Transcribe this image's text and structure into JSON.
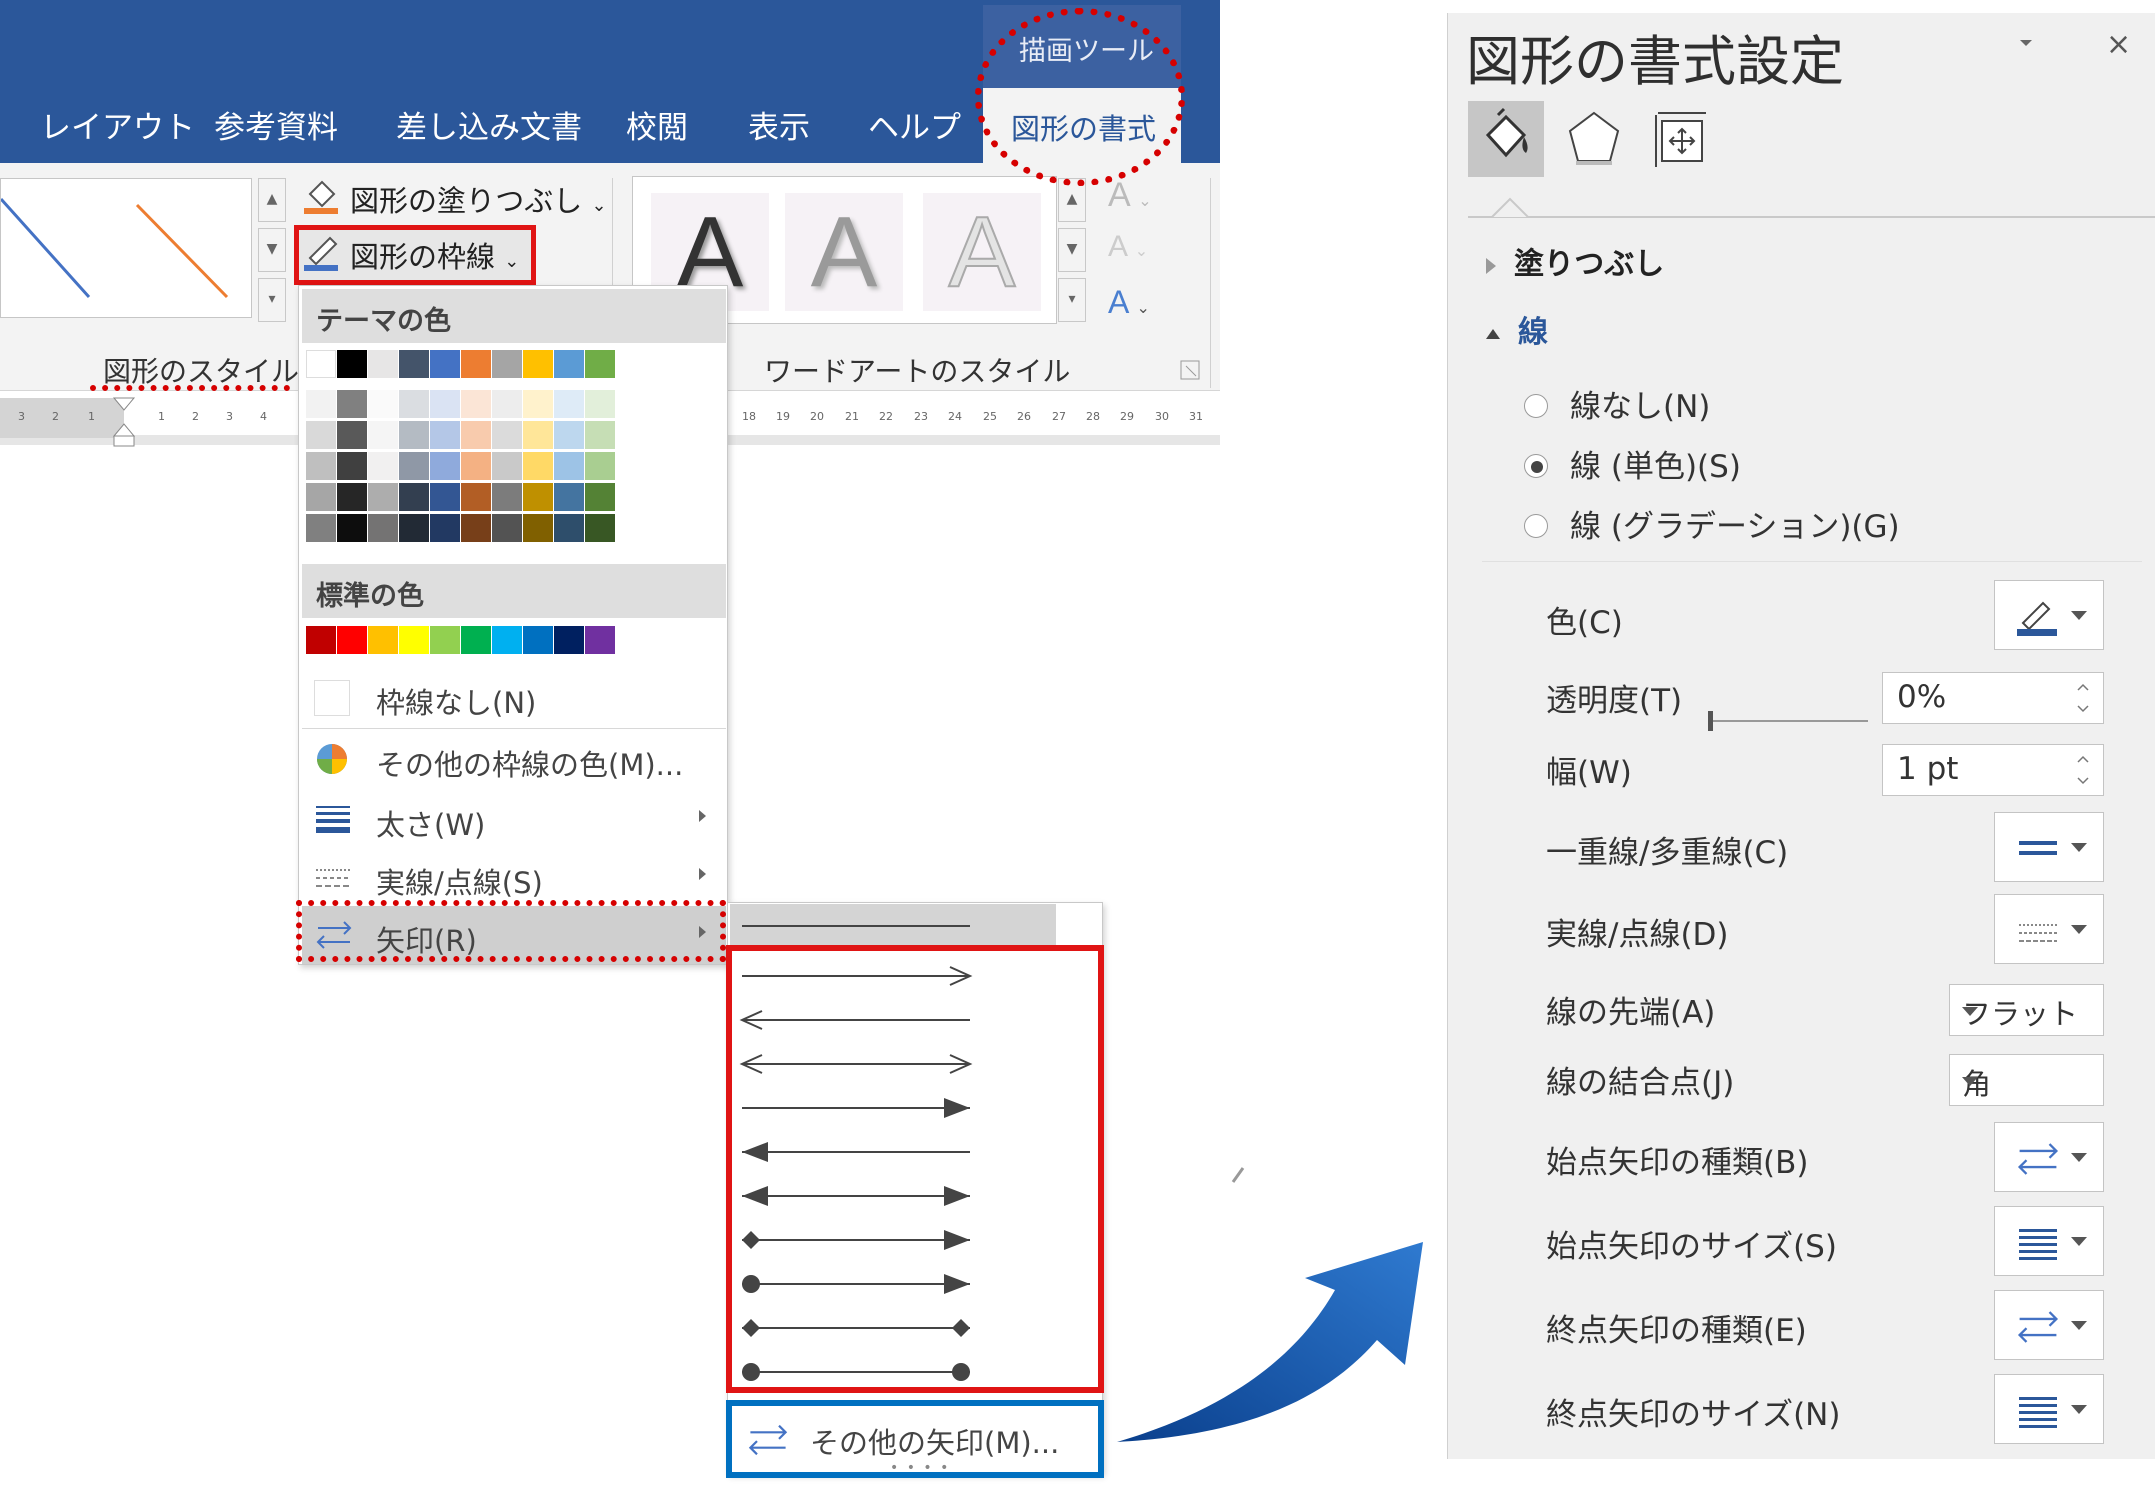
{
  "ribbon": {
    "tabs": [
      "レイアウト",
      "参考資料",
      "差し込み文書",
      "校閲",
      "表示",
      "ヘルプ"
    ],
    "contextual_group": "描画ツール",
    "active_tab": "図形の書式",
    "fill_command": "図形の塗りつぶし",
    "outline_command": "図形の枠線",
    "shape_styles_label": "図形のスタイル",
    "wordart_styles_label": "ワードアートのスタイル",
    "wordart_letter": "A"
  },
  "ruler": {
    "ticks": [
      "3",
      "2",
      "1",
      "1",
      "2",
      "3",
      "4",
      "18",
      "19",
      "20",
      "21",
      "22",
      "23",
      "24",
      "25",
      "26",
      "27",
      "28",
      "29",
      "30",
      "31"
    ]
  },
  "outline_menu": {
    "theme_colors_header": "テーマの色",
    "standard_colors_header": "標準の色",
    "theme_colors": [
      "#ffffff",
      "#000000",
      "#e7e6e6",
      "#44546a",
      "#4472c4",
      "#ed7d31",
      "#a5a5a5",
      "#ffc000",
      "#5b9bd5",
      "#70ad47"
    ],
    "standard_colors": [
      "#c00000",
      "#ff0000",
      "#ffc000",
      "#ffff00",
      "#92d050",
      "#00b050",
      "#00b0f0",
      "#0070c0",
      "#002060",
      "#7030a0"
    ],
    "no_outline": "枠線なし(N)",
    "more_colors": "その他の枠線の色(M)...",
    "weight": "太さ(W)",
    "dashes": "実線/点線(S)",
    "arrows": "矢印(R)"
  },
  "arrow_submenu": {
    "more_arrows": "その他の矢印(M)..."
  },
  "format_pane": {
    "title": "図形の書式設定",
    "close": "×",
    "fill_section": "塗りつぶし",
    "line_section": "線",
    "radio_options": [
      {
        "label": "線なし(N)",
        "checked": false
      },
      {
        "label": "線 (単色)(S)",
        "checked": true
      },
      {
        "label": "線 (グラデーション)(G)",
        "checked": false
      }
    ],
    "color_label": "色(C)",
    "transparency_label": "透明度(T)",
    "transparency_value": "0%",
    "width_label": "幅(W)",
    "width_value": "1 pt",
    "compound_label": "一重線/多重線(C)",
    "dash_label": "実線/点線(D)",
    "cap_label": "線の先端(A)",
    "cap_value": "フラット",
    "join_label": "線の結合点(J)",
    "join_value": "角",
    "begin_type_label": "始点矢印の種類(B)",
    "begin_size_label": "始点矢印のサイズ(S)",
    "end_type_label": "終点矢印の種類(E)",
    "end_size_label": "終点矢印のサイズ(N)"
  },
  "colors": {
    "ribbon": "#2b579a",
    "highlight_red": "#e01414",
    "highlight_blue": "#0070c0"
  }
}
